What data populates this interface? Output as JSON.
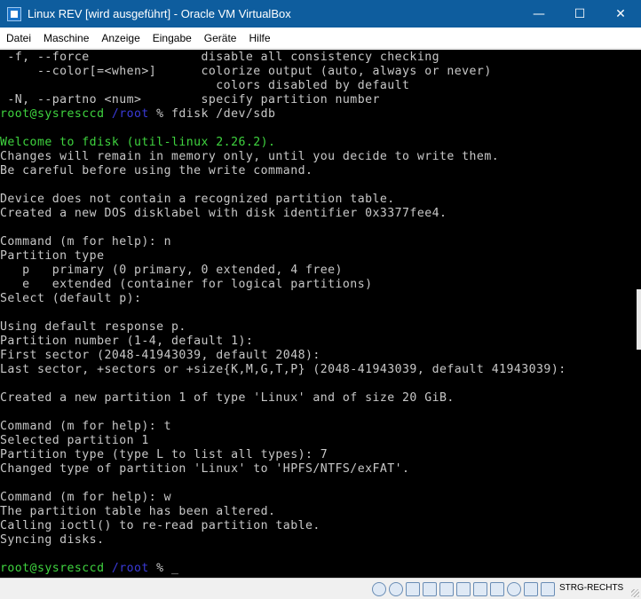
{
  "window": {
    "title": "Linux REV [wird ausgeführt] - Oracle VM VirtualBox",
    "controls": {
      "minimize": "—",
      "maximize": "☐",
      "close": "✕"
    }
  },
  "menu": [
    "Datei",
    "Maschine",
    "Anzeige",
    "Eingabe",
    "Geräte",
    "Hilfe"
  ],
  "terminal": {
    "lines": [
      [
        {
          "t": " -f, --force               disable all consistency checking",
          "c": ""
        }
      ],
      [
        {
          "t": "     --color[=<when>]      colorize output (auto, always or never)",
          "c": ""
        }
      ],
      [
        {
          "t": "                             colors disabled by default",
          "c": ""
        }
      ],
      [
        {
          "t": " -N, --partno <num>        specify partition number",
          "c": ""
        }
      ],
      [
        {
          "t": "root@sysresccd ",
          "c": "green"
        },
        {
          "t": "/root",
          "c": "blue"
        },
        {
          "t": " % fdisk /dev/sdb",
          "c": ""
        }
      ],
      [
        {
          "t": "",
          "c": ""
        }
      ],
      [
        {
          "t": "Welcome to fdisk (util-linux 2.26.2).",
          "c": "green"
        }
      ],
      [
        {
          "t": "Changes will remain in memory only, until you decide to write them.",
          "c": ""
        }
      ],
      [
        {
          "t": "Be careful before using the write command.",
          "c": ""
        }
      ],
      [
        {
          "t": "",
          "c": ""
        }
      ],
      [
        {
          "t": "Device does not contain a recognized partition table.",
          "c": ""
        }
      ],
      [
        {
          "t": "Created a new DOS disklabel with disk identifier 0x3377fee4.",
          "c": ""
        }
      ],
      [
        {
          "t": "",
          "c": ""
        }
      ],
      [
        {
          "t": "Command (m for help): n",
          "c": ""
        }
      ],
      [
        {
          "t": "Partition type",
          "c": ""
        }
      ],
      [
        {
          "t": "   p   primary (0 primary, 0 extended, 4 free)",
          "c": ""
        }
      ],
      [
        {
          "t": "   e   extended (container for logical partitions)",
          "c": ""
        }
      ],
      [
        {
          "t": "Select (default p):",
          "c": ""
        }
      ],
      [
        {
          "t": "",
          "c": ""
        }
      ],
      [
        {
          "t": "Using default response p.",
          "c": ""
        }
      ],
      [
        {
          "t": "Partition number (1-4, default 1):",
          "c": ""
        }
      ],
      [
        {
          "t": "First sector (2048-41943039, default 2048):",
          "c": ""
        }
      ],
      [
        {
          "t": "Last sector, +sectors or +size{K,M,G,T,P} (2048-41943039, default 41943039):",
          "c": ""
        }
      ],
      [
        {
          "t": "",
          "c": ""
        }
      ],
      [
        {
          "t": "Created a new partition 1 of type 'Linux' and of size 20 GiB.",
          "c": ""
        }
      ],
      [
        {
          "t": "",
          "c": ""
        }
      ],
      [
        {
          "t": "Command (m for help): t",
          "c": ""
        }
      ],
      [
        {
          "t": "Selected partition 1",
          "c": ""
        }
      ],
      [
        {
          "t": "Partition type (type L to list all types): 7",
          "c": ""
        }
      ],
      [
        {
          "t": "Changed type of partition 'Linux' to 'HPFS/NTFS/exFAT'.",
          "c": ""
        }
      ],
      [
        {
          "t": "",
          "c": ""
        }
      ],
      [
        {
          "t": "Command (m for help): w",
          "c": ""
        }
      ],
      [
        {
          "t": "The partition table has been altered.",
          "c": ""
        }
      ],
      [
        {
          "t": "Calling ioctl() to re-read partition table.",
          "c": ""
        }
      ],
      [
        {
          "t": "Syncing disks.",
          "c": ""
        }
      ],
      [
        {
          "t": "",
          "c": ""
        }
      ],
      [
        {
          "t": "root@sysresccd ",
          "c": "green"
        },
        {
          "t": "/root",
          "c": "blue"
        },
        {
          "t": " % ",
          "c": ""
        },
        {
          "t": "_",
          "c": "cursor"
        }
      ]
    ]
  },
  "statusbar": {
    "icons": [
      "hard-disk-icon",
      "optical-drive-icon",
      "audio-icon",
      "network-icon",
      "shared-folders-icon",
      "display-icon",
      "video-capture-icon",
      "usb-icon",
      "mouse-integration-icon",
      "cpu-icon",
      "keyboard-capture-icon"
    ],
    "host_key": "STRG-RECHTS"
  },
  "colors": {
    "titlebar": "#0e5d9e",
    "terminal_bg": "#000000",
    "terminal_fg": "#c8c8c8",
    "prompt_green": "#3fd43f",
    "path_blue": "#3a3ad8"
  }
}
